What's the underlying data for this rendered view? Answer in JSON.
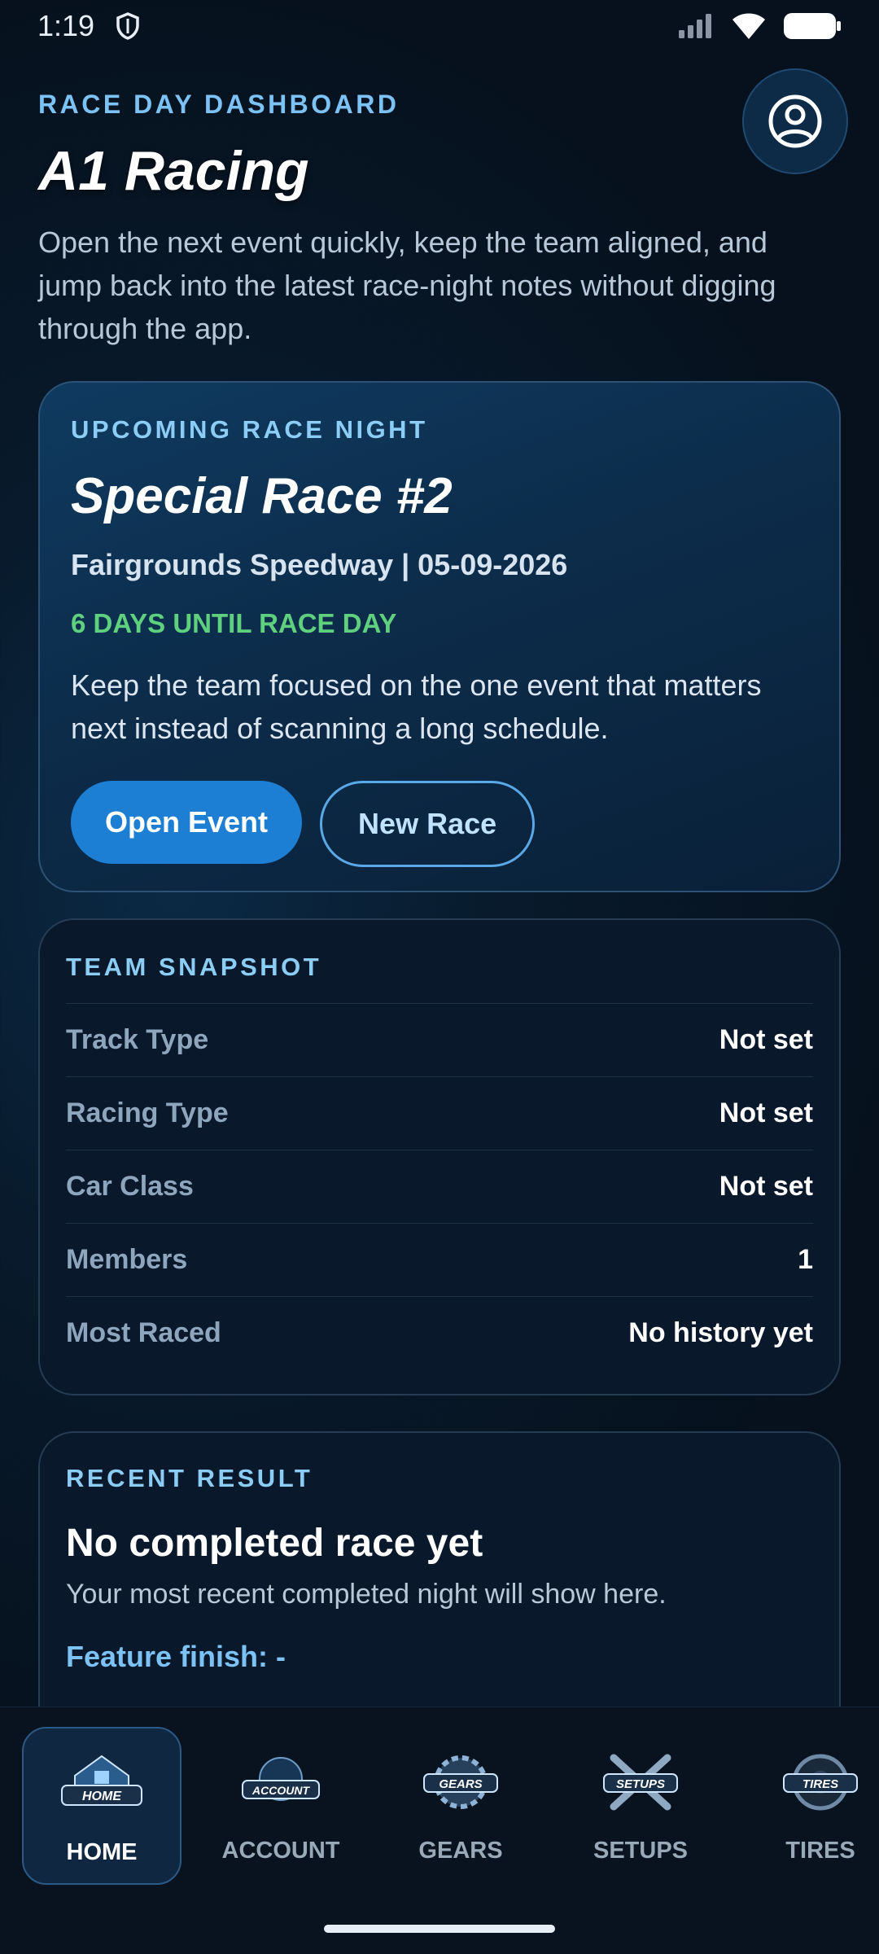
{
  "status_bar": {
    "time": "1:19"
  },
  "header": {
    "eyebrow": "RACE DAY DASHBOARD",
    "title": "A1 Racing",
    "intro": "Open the next event quickly, keep the team aligned, and jump back into the latest race-night notes without digging through the app."
  },
  "upcoming": {
    "eyebrow": "UPCOMING RACE NIGHT",
    "race_name": "Special Race #2",
    "meta": "Fairgrounds Speedway | 05-09-2026",
    "countdown": "6 DAYS UNTIL RACE DAY",
    "description": "Keep the team focused on the one event that matters next instead of scanning a long schedule.",
    "open_button": "Open Event",
    "new_button": "New Race"
  },
  "snapshot": {
    "eyebrow": "TEAM SNAPSHOT",
    "rows": [
      {
        "label": "Track Type",
        "value": "Not set"
      },
      {
        "label": "Racing Type",
        "value": "Not set"
      },
      {
        "label": "Car Class",
        "value": "Not set"
      },
      {
        "label": "Members",
        "value": "1"
      },
      {
        "label": "Most Raced",
        "value": "No history yet"
      }
    ]
  },
  "recent": {
    "eyebrow": "RECENT RESULT",
    "title": "No completed race yet",
    "description": "Your most recent completed night will show here.",
    "finish": "Feature finish: -"
  },
  "nav": {
    "items": [
      {
        "label": "HOME",
        "badge": "HOME",
        "active": true
      },
      {
        "label": "ACCOUNT",
        "badge": "ACCOUNT",
        "active": false
      },
      {
        "label": "GEARS",
        "badge": "GEARS",
        "active": false
      },
      {
        "label": "SETUPS",
        "badge": "SETUPS",
        "active": false
      },
      {
        "label": "TIRES",
        "badge": "TIRES",
        "active": false
      }
    ]
  },
  "colors": {
    "accent": "#1c7fd4",
    "eyebrow": "#7cc2f5",
    "countdown": "#5fd07e",
    "background": "#06111d"
  }
}
